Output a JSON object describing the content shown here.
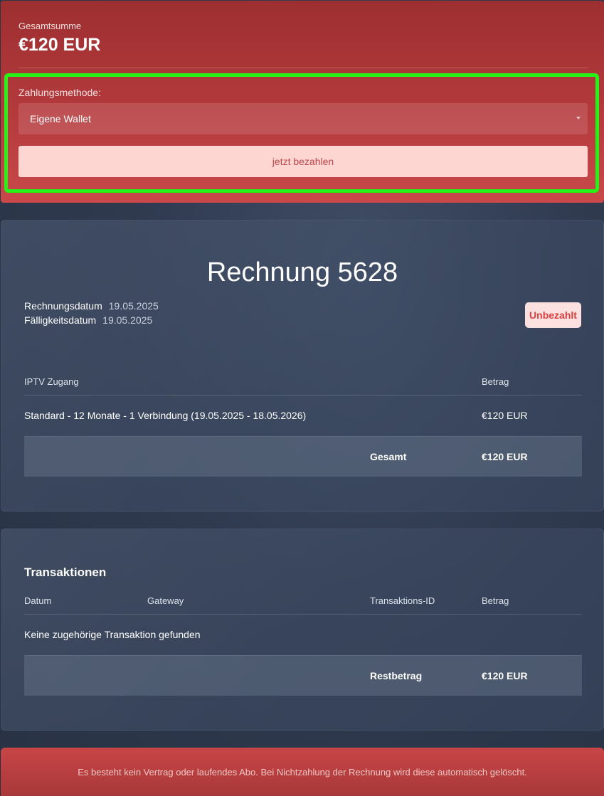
{
  "payment": {
    "total_label": "Gesamtsumme",
    "total_value": "€120 EUR",
    "method_label": "Zahlungsmethode:",
    "method_selected": "Eigene Wallet",
    "pay_button": "jetzt bezahlen"
  },
  "invoice": {
    "title": "Rechnung 5628",
    "invoice_date_label": "Rechnungsdatum",
    "invoice_date": "19.05.2025",
    "due_date_label": "Fälligkeitsdatum",
    "due_date": "19.05.2025",
    "status": "Unbezahlt",
    "columns": [
      "IPTV Zugang",
      "Betrag"
    ],
    "items": [
      {
        "description": "Standard - 12 Monate - 1 Verbindung (19.05.2025 - 18.05.2026)",
        "amount": "€120 EUR"
      }
    ],
    "total_label": "Gesamt",
    "total_amount": "€120 EUR"
  },
  "transactions": {
    "title": "Transaktionen",
    "columns": [
      "Datum",
      "Gateway",
      "Transaktions-ID",
      "Betrag"
    ],
    "empty_message": "Keine zugehörige Transaktion gefunden",
    "balance_label": "Restbetrag",
    "balance_amount": "€120 EUR"
  },
  "notice": "Es besteht kein Vertrag oder laufendes Abo. Bei Nichtzahlung der Rechnung wird diese automatisch gelöscht.",
  "colors": {
    "payment_header": "#b43a3c",
    "highlight_border": "#27f218",
    "pay_button_bg": "#fdd6d1",
    "status_unpaid": "#d9403f",
    "page_background": "#2f3a4f"
  }
}
